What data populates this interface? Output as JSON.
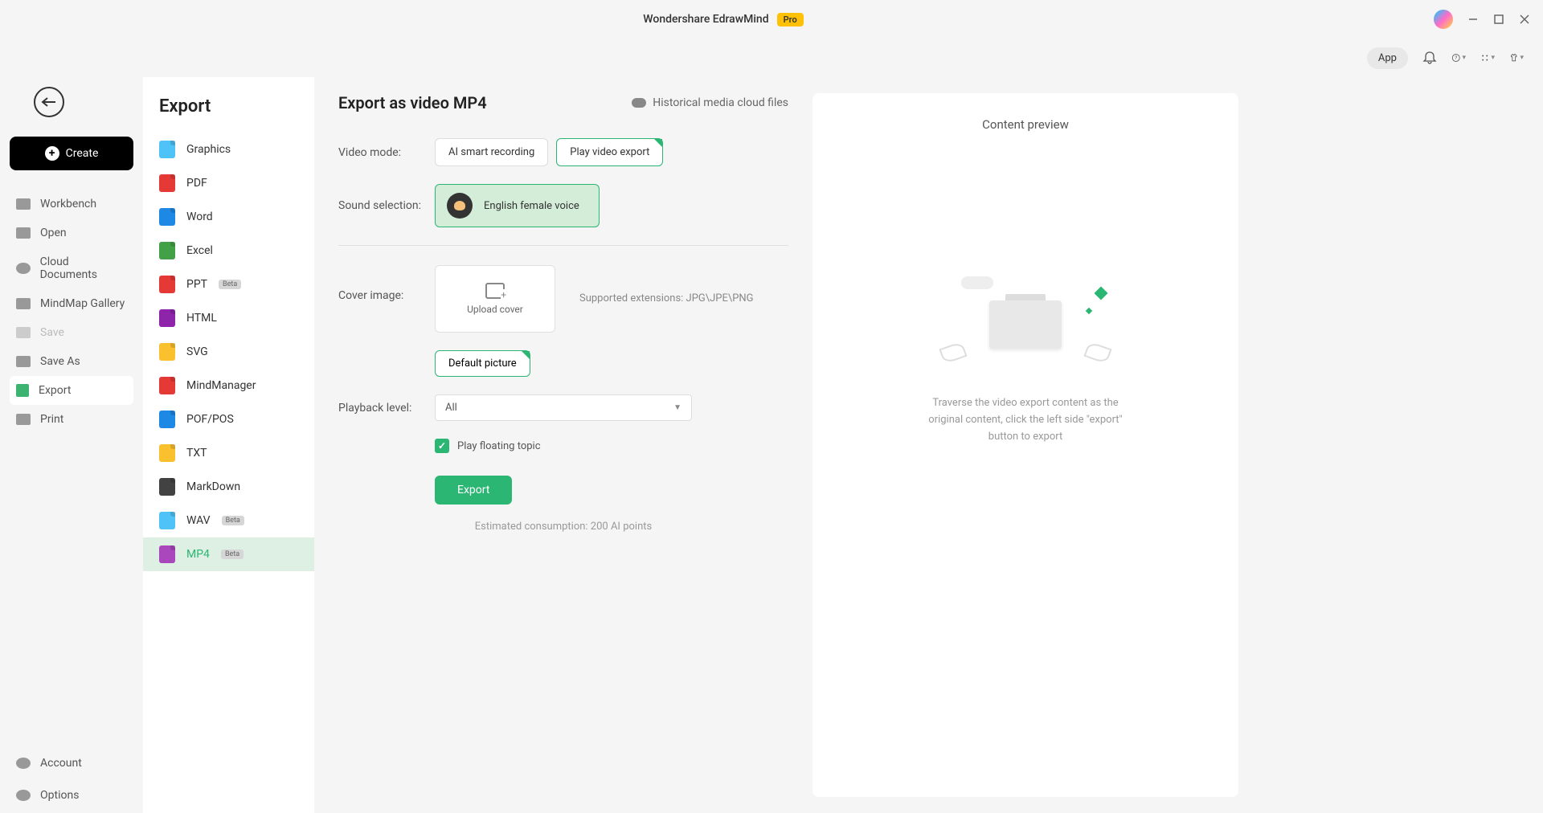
{
  "titlebar": {
    "appName": "Wondershare EdrawMind",
    "badge": "Pro"
  },
  "toolbar": {
    "appButton": "App"
  },
  "sidebar": {
    "createLabel": "Create",
    "items": [
      {
        "label": "Workbench"
      },
      {
        "label": "Open"
      },
      {
        "label": "Cloud Documents"
      },
      {
        "label": "MindMap Gallery"
      },
      {
        "label": "Save"
      },
      {
        "label": "Save As"
      },
      {
        "label": "Export"
      },
      {
        "label": "Print"
      }
    ],
    "bottom": [
      {
        "label": "Account"
      },
      {
        "label": "Options"
      }
    ]
  },
  "exportPanel": {
    "title": "Export",
    "formats": [
      {
        "label": "Graphics",
        "color": "#4fc3f7"
      },
      {
        "label": "PDF",
        "color": "#e53935"
      },
      {
        "label": "Word",
        "color": "#1e88e5"
      },
      {
        "label": "Excel",
        "color": "#43a047"
      },
      {
        "label": "PPT",
        "color": "#e53935",
        "beta": "Beta"
      },
      {
        "label": "HTML",
        "color": "#8e24aa"
      },
      {
        "label": "SVG",
        "color": "#fbc02d"
      },
      {
        "label": "MindManager",
        "color": "#e53935"
      },
      {
        "label": "POF/POS",
        "color": "#1e88e5"
      },
      {
        "label": "TXT",
        "color": "#fbc02d"
      },
      {
        "label": "MarkDown",
        "color": "#424242"
      },
      {
        "label": "WAV",
        "color": "#4fc3f7",
        "beta": "Beta"
      },
      {
        "label": "MP4",
        "color": "#ab47bc",
        "beta": "Beta"
      }
    ]
  },
  "main": {
    "title": "Export as video MP4",
    "historicalLink": "Historical media cloud files",
    "labels": {
      "videoMode": "Video mode:",
      "soundSelection": "Sound selection:",
      "coverImage": "Cover image:",
      "playbackLevel": "Playback level:"
    },
    "videoModes": {
      "ai": "AI smart recording",
      "play": "Play video export"
    },
    "voice": "English female voice",
    "uploadCover": "Upload cover",
    "supportExt": "Supported extensions: JPG\\JPE\\PNG",
    "defaultPicture": "Default picture",
    "playbackValue": "All",
    "floatingTopic": "Play floating topic",
    "exportBtn": "Export",
    "consumption": "Estimated consumption: 200 AI points"
  },
  "preview": {
    "title": "Content preview",
    "description": "Traverse the video export content as the original content, click the left side \"export\" button to export"
  }
}
